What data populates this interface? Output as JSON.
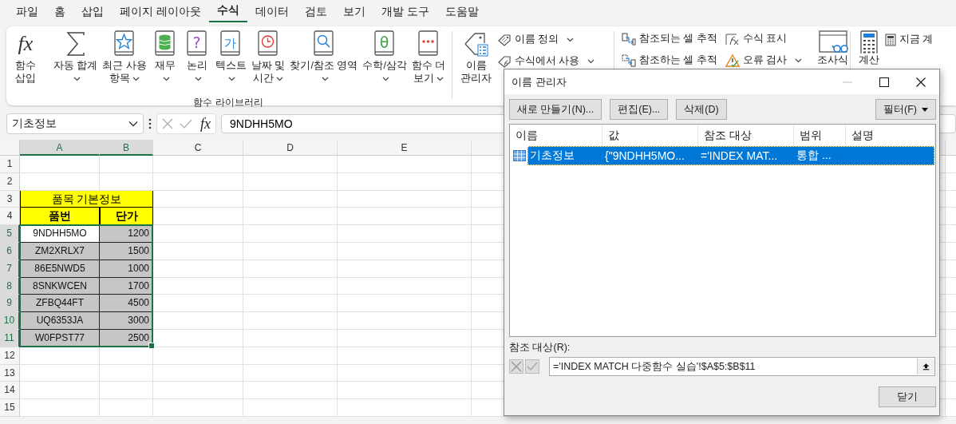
{
  "menu_tabs": [
    {
      "label": "파일",
      "selected": false
    },
    {
      "label": "홈",
      "selected": false
    },
    {
      "label": "삽입",
      "selected": false
    },
    {
      "label": "페이지 레이아웃",
      "selected": false
    },
    {
      "label": "수식",
      "selected": true
    },
    {
      "label": "데이터",
      "selected": false
    },
    {
      "label": "검토",
      "selected": false
    },
    {
      "label": "보기",
      "selected": false
    },
    {
      "label": "개발 도구",
      "selected": false
    },
    {
      "label": "도움말",
      "selected": false
    }
  ],
  "ribbon": {
    "function_library": {
      "label": "함수 라이브러리",
      "buttons": [
        {
          "kind": "fx",
          "glyph": "fx",
          "lines": [
            "함수",
            "삽입"
          ],
          "dropdown": false
        },
        {
          "kind": "sum",
          "lines": [
            "자동 합계"
          ],
          "dropdown": true
        },
        {
          "kind": "star",
          "lines": [
            "최근 사용",
            "항목"
          ],
          "dropdown": true
        },
        {
          "kind": "database",
          "lines": [
            "재무"
          ],
          "dropdown": true
        },
        {
          "kind": "question",
          "glyph": "?",
          "lines": [
            "논리"
          ],
          "dropdown": true
        },
        {
          "kind": "hangul",
          "glyph": "가",
          "lines": [
            "텍스트"
          ],
          "dropdown": true
        },
        {
          "kind": "clock",
          "lines": [
            "날짜 및",
            "시간"
          ],
          "dropdown": true
        },
        {
          "kind": "search",
          "lines": [
            "찾기/참조 영역"
          ],
          "dropdown": true
        },
        {
          "kind": "theta",
          "glyph": "θ",
          "lines": [
            "수학/삼각"
          ],
          "dropdown": true
        },
        {
          "kind": "dots",
          "lines": [
            "함수 더",
            "보기"
          ],
          "dropdown": true
        }
      ]
    },
    "defined_names": {
      "manager": {
        "lines": [
          "이름",
          "관리자"
        ]
      },
      "items": [
        {
          "kind": "tag",
          "label": "이름 정의",
          "dropdown": true
        },
        {
          "kind": "formula-tag",
          "label": "수식에서 사용",
          "dropdown": true
        }
      ]
    },
    "auditing": {
      "items": [
        {
          "kind": "precedents",
          "label": "참조되는 셀 추적",
          "dropdown": false
        },
        {
          "kind": "dependents",
          "label": "참조하는 셀 추적",
          "dropdown": false
        },
        {
          "kind": "show-formulas",
          "label": "수식 표시",
          "dropdown": false
        },
        {
          "kind": "error-check",
          "label": "오류 검사",
          "dropdown": true
        }
      ],
      "watch": {
        "label": "조사식"
      }
    },
    "calculation": {
      "options": {
        "label": "계산"
      },
      "items": [
        {
          "kind": "calculator",
          "label": "지금 계"
        }
      ]
    }
  },
  "formula_bar": {
    "name_box": "기초정보",
    "fx": "fx",
    "formula": "9NDHH5MO"
  },
  "sheet": {
    "columns": [
      {
        "label": "A",
        "selected": true
      },
      {
        "label": "B",
        "selected": true
      },
      {
        "label": "C",
        "selected": false
      },
      {
        "label": "D",
        "selected": false
      },
      {
        "label": "E",
        "selected": false
      }
    ],
    "rows": [
      {
        "label": "1",
        "selected": false
      },
      {
        "label": "2",
        "selected": false
      },
      {
        "label": "3",
        "selected": false
      },
      {
        "label": "4",
        "selected": false
      },
      {
        "label": "5",
        "selected": true
      },
      {
        "label": "6",
        "selected": true
      },
      {
        "label": "7",
        "selected": true
      },
      {
        "label": "8",
        "selected": true
      },
      {
        "label": "9",
        "selected": true
      },
      {
        "label": "10",
        "selected": true
      },
      {
        "label": "11",
        "selected": true
      },
      {
        "label": "12",
        "selected": false
      },
      {
        "label": "13",
        "selected": false
      },
      {
        "label": "14",
        "selected": false
      },
      {
        "label": "15",
        "selected": false
      }
    ],
    "table": {
      "title": "품목 기본정보",
      "headers": [
        "품번",
        "단가"
      ],
      "items": [
        {
          "code": "9NDHH5MO",
          "price": "1200",
          "active": true
        },
        {
          "code": "ZM2XRLX7",
          "price": "1500",
          "active": false
        },
        {
          "code": "86E5NWD5",
          "price": "1000",
          "active": false
        },
        {
          "code": "8SNKWCEN",
          "price": "1700",
          "active": false
        },
        {
          "code": "ZFBQ44FT",
          "price": "4500",
          "active": false
        },
        {
          "code": "UQ6353JA",
          "price": "3000",
          "active": false
        },
        {
          "code": "W0FPST77",
          "price": "2500",
          "active": false
        }
      ]
    }
  },
  "dialog": {
    "title": "이름 관리자",
    "buttons": [
      {
        "label": "새로 만들기(N)..."
      },
      {
        "label": "편집(E)..."
      },
      {
        "label": "삭제(D)"
      }
    ],
    "filter": {
      "label": "필터(F)"
    },
    "columns": [
      "이름",
      "값",
      "참조 대상",
      "범위",
      "설명"
    ],
    "rows": [
      {
        "name": "기초정보",
        "value": "{\"9NDHH5MO...",
        "refers_to": "='INDEX MAT...",
        "scope": "통합 ...",
        "selected": true
      }
    ],
    "refers_label": "참조 대상(R):",
    "refers_value": "='INDEX MATCH 다중함수 실습'!$A$5:$B$11",
    "close": "닫기"
  }
}
